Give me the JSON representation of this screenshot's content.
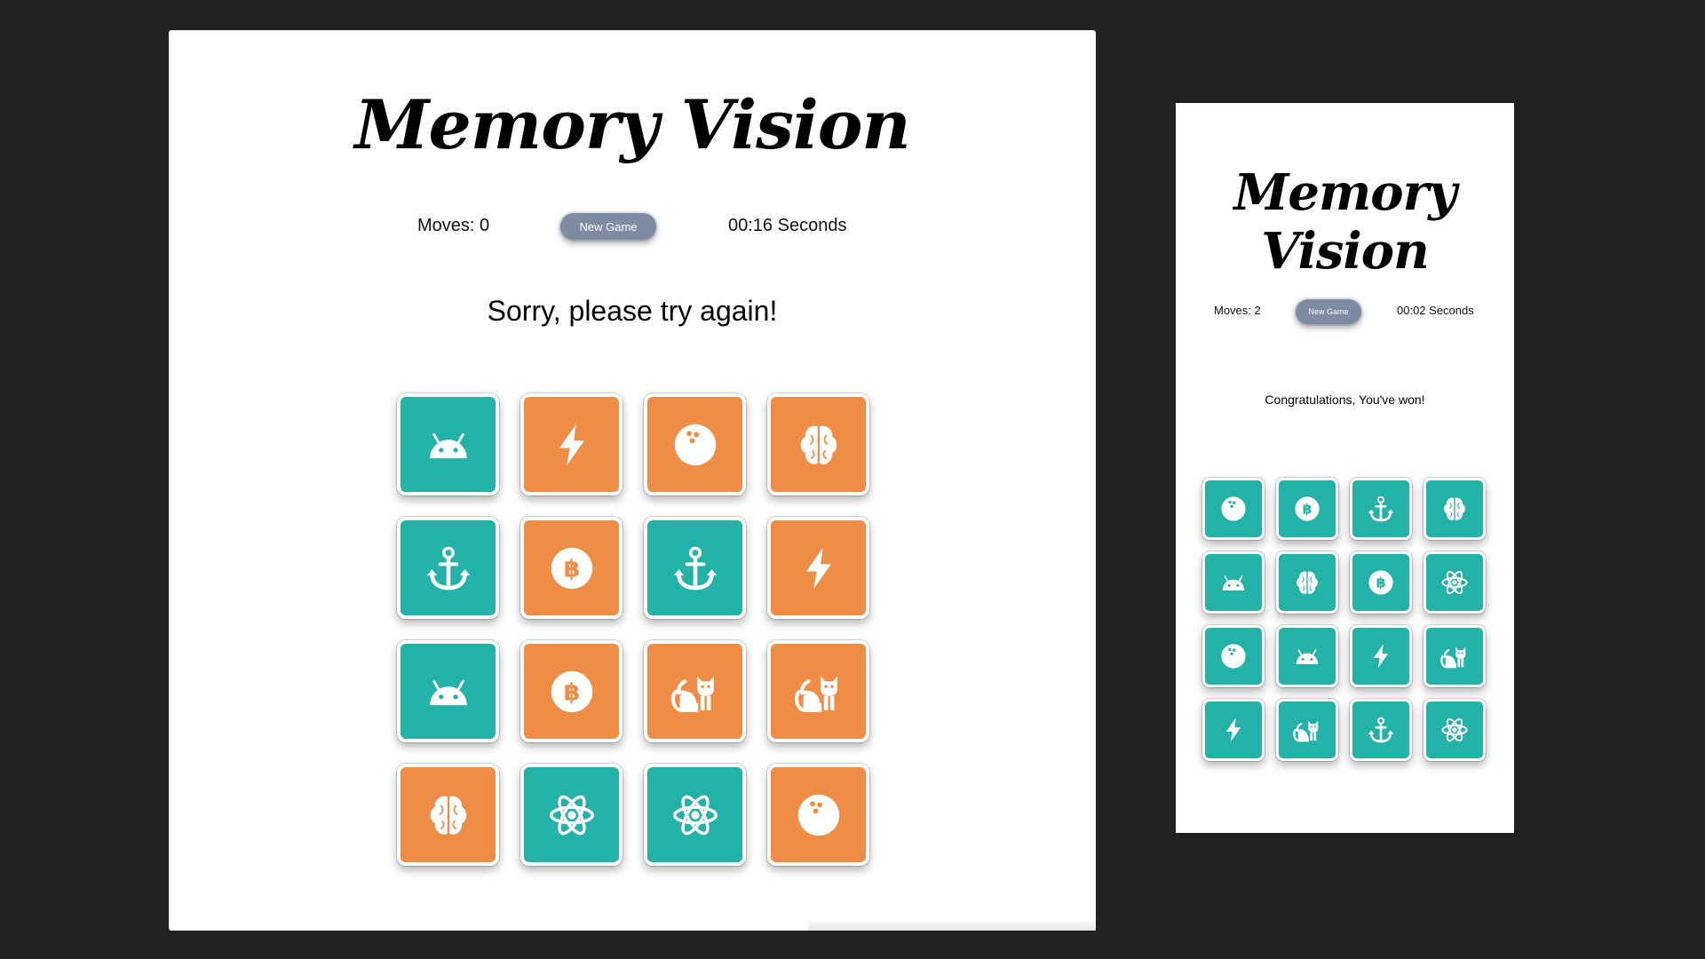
{
  "desktop": {
    "title": "Memory Vision",
    "moves": "Moves: 0",
    "new_game_label": "New Game",
    "timer": "00:16 Seconds",
    "message": "Sorry, please try again!",
    "cards": [
      {
        "icon": "android-icon",
        "color": "teal"
      },
      {
        "icon": "bolt-icon",
        "color": "orange"
      },
      {
        "icon": "bowling-ball-icon",
        "color": "orange"
      },
      {
        "icon": "brain-icon",
        "color": "orange"
      },
      {
        "icon": "anchor-icon",
        "color": "teal"
      },
      {
        "icon": "bitcoin-icon",
        "color": "orange"
      },
      {
        "icon": "anchor-icon",
        "color": "teal"
      },
      {
        "icon": "bolt-icon",
        "color": "orange"
      },
      {
        "icon": "android-icon",
        "color": "teal"
      },
      {
        "icon": "bitcoin-icon",
        "color": "orange"
      },
      {
        "icon": "cat-icon",
        "color": "orange"
      },
      {
        "icon": "cat-icon",
        "color": "orange"
      },
      {
        "icon": "brain-icon",
        "color": "orange"
      },
      {
        "icon": "atom-icon",
        "color": "teal"
      },
      {
        "icon": "atom-icon",
        "color": "teal"
      },
      {
        "icon": "bowling-ball-icon",
        "color": "orange"
      }
    ]
  },
  "mobile": {
    "title": "Memory Vision",
    "moves": "Moves: 2",
    "new_game_label": "New Game",
    "timer": "00:02 Seconds",
    "message": "Congratulations, You've won!",
    "cards": [
      {
        "icon": "bowling-ball-icon",
        "color": "teal"
      },
      {
        "icon": "bitcoin-icon",
        "color": "teal"
      },
      {
        "icon": "anchor-icon",
        "color": "teal"
      },
      {
        "icon": "brain-icon",
        "color": "teal"
      },
      {
        "icon": "android-icon",
        "color": "teal"
      },
      {
        "icon": "brain-icon",
        "color": "teal"
      },
      {
        "icon": "bitcoin-icon",
        "color": "teal"
      },
      {
        "icon": "atom-icon",
        "color": "teal"
      },
      {
        "icon": "bowling-ball-icon",
        "color": "teal"
      },
      {
        "icon": "android-icon",
        "color": "teal"
      },
      {
        "icon": "bolt-icon",
        "color": "teal"
      },
      {
        "icon": "cat-icon",
        "color": "teal"
      },
      {
        "icon": "bolt-icon",
        "color": "teal"
      },
      {
        "icon": "cat-icon",
        "color": "teal"
      },
      {
        "icon": "anchor-icon",
        "color": "teal"
      },
      {
        "icon": "atom-icon",
        "color": "teal"
      }
    ]
  },
  "colors": {
    "teal": "#22b2a7",
    "orange": "#ef8c45",
    "button": "#7d8ba3",
    "background": "#212121"
  }
}
